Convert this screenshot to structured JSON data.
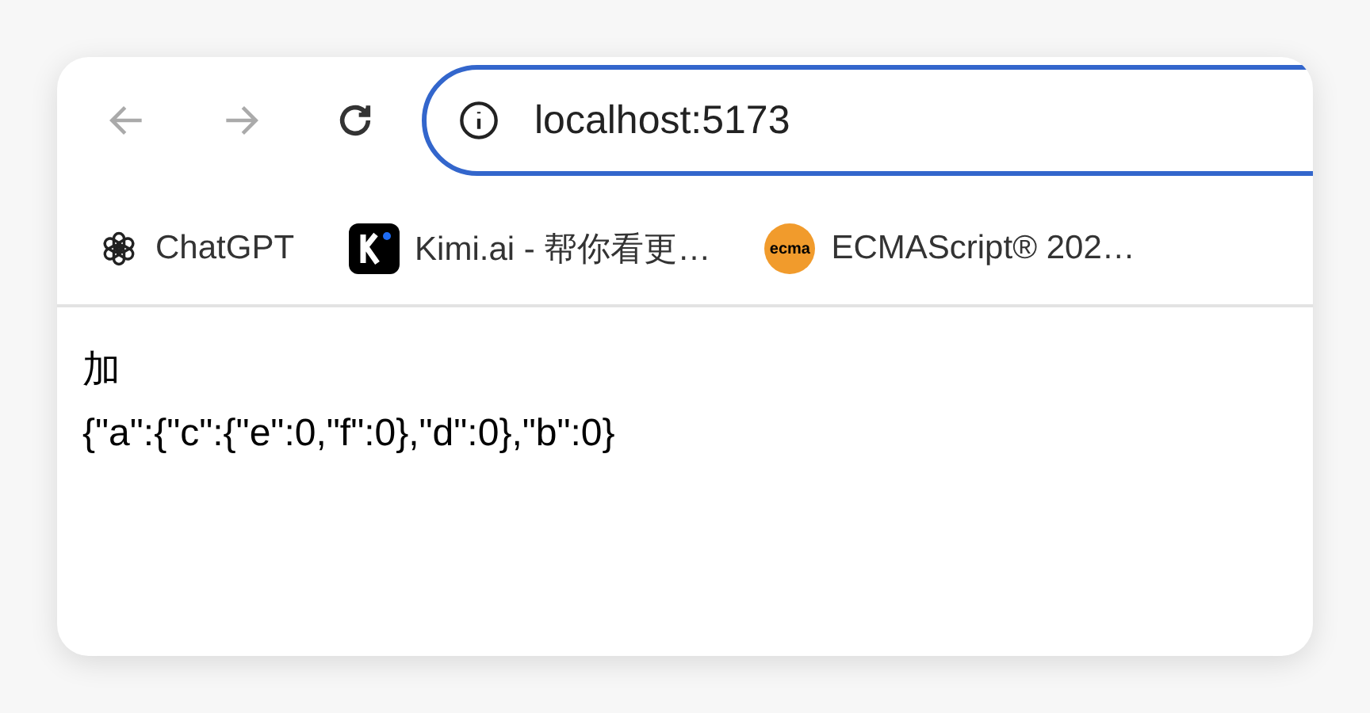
{
  "toolbar": {
    "address": "localhost:5173"
  },
  "bookmarks": [
    {
      "kind": "chatgpt",
      "label": "ChatGPT"
    },
    {
      "kind": "kimi",
      "label": "Kimi.ai - 帮你看更…"
    },
    {
      "kind": "ecma",
      "label": "ECMAScript® 202…",
      "icon_text": "ecma"
    }
  ],
  "page": {
    "lines": [
      "加",
      "{\"a\":{\"c\":{\"e\":0,\"f\":0},\"d\":0},\"b\":0}"
    ]
  }
}
